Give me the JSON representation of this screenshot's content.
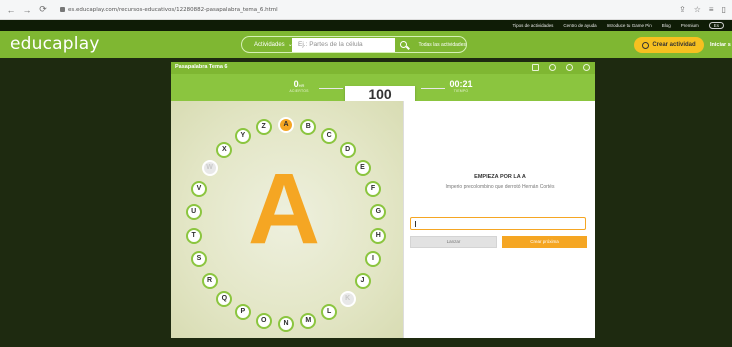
{
  "browser": {
    "url": "es.educaplay.com/recursos-educativos/12280882-pasapalabra_tema_6.html"
  },
  "top_links": [
    "Tipos de actividades",
    "Centro de ayuda",
    "Introduce tu Game Pin",
    "Blog",
    "Premium",
    "Es"
  ],
  "header": {
    "logo": "educaplay",
    "activities_label": "Actividades",
    "search_placeholder": "Ej.: Partes de la célula",
    "all_activities": "Todas las actividades",
    "create_button": "Crear actividad",
    "login": "Iniciar s"
  },
  "game": {
    "title": "Pasapalabra Tema 6",
    "score_value": "0",
    "score_unit": "HR",
    "score_label": "ACIERTOS",
    "remaining_value": "100",
    "remaining_label": "PASOS",
    "time_value": "00:21",
    "time_label": "TIEMPO",
    "big_letter": "A",
    "letters": [
      "A",
      "B",
      "C",
      "D",
      "E",
      "F",
      "G",
      "H",
      "I",
      "J",
      "K",
      "L",
      "M",
      "N",
      "O",
      "P",
      "Q",
      "R",
      "S",
      "T",
      "U",
      "V",
      "W",
      "X",
      "Y",
      "Z"
    ],
    "active_letter": "A",
    "skipped_letters": [
      "K",
      "W"
    ],
    "clue_title": "EMPIEZA POR LA A",
    "clue_text": "Imperio precolombino que derrotó Hernán Cortés",
    "answer_value": "",
    "check_button": "Lanzar",
    "next_button": "Crear próxima"
  },
  "colors": {
    "brand_green": "#7fb732",
    "accent_orange": "#f5a623",
    "dark_bg": "#1e2a10"
  }
}
